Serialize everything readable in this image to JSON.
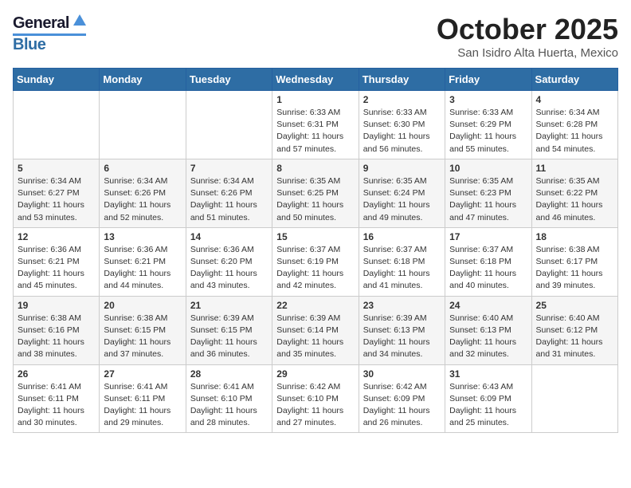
{
  "logo": {
    "general": "General",
    "blue": "Blue"
  },
  "header": {
    "month": "October 2025",
    "location": "San Isidro Alta Huerta, Mexico"
  },
  "days": [
    "Sunday",
    "Monday",
    "Tuesday",
    "Wednesday",
    "Thursday",
    "Friday",
    "Saturday"
  ],
  "weeks": [
    [
      {
        "day": "",
        "info": ""
      },
      {
        "day": "",
        "info": ""
      },
      {
        "day": "",
        "info": ""
      },
      {
        "day": "1",
        "sunrise": "Sunrise: 6:33 AM",
        "sunset": "Sunset: 6:31 PM",
        "daylight": "Daylight: 11 hours and 57 minutes."
      },
      {
        "day": "2",
        "sunrise": "Sunrise: 6:33 AM",
        "sunset": "Sunset: 6:30 PM",
        "daylight": "Daylight: 11 hours and 56 minutes."
      },
      {
        "day": "3",
        "sunrise": "Sunrise: 6:33 AM",
        "sunset": "Sunset: 6:29 PM",
        "daylight": "Daylight: 11 hours and 55 minutes."
      },
      {
        "day": "4",
        "sunrise": "Sunrise: 6:34 AM",
        "sunset": "Sunset: 6:28 PM",
        "daylight": "Daylight: 11 hours and 54 minutes."
      }
    ],
    [
      {
        "day": "5",
        "sunrise": "Sunrise: 6:34 AM",
        "sunset": "Sunset: 6:27 PM",
        "daylight": "Daylight: 11 hours and 53 minutes."
      },
      {
        "day": "6",
        "sunrise": "Sunrise: 6:34 AM",
        "sunset": "Sunset: 6:26 PM",
        "daylight": "Daylight: 11 hours and 52 minutes."
      },
      {
        "day": "7",
        "sunrise": "Sunrise: 6:34 AM",
        "sunset": "Sunset: 6:26 PM",
        "daylight": "Daylight: 11 hours and 51 minutes."
      },
      {
        "day": "8",
        "sunrise": "Sunrise: 6:35 AM",
        "sunset": "Sunset: 6:25 PM",
        "daylight": "Daylight: 11 hours and 50 minutes."
      },
      {
        "day": "9",
        "sunrise": "Sunrise: 6:35 AM",
        "sunset": "Sunset: 6:24 PM",
        "daylight": "Daylight: 11 hours and 49 minutes."
      },
      {
        "day": "10",
        "sunrise": "Sunrise: 6:35 AM",
        "sunset": "Sunset: 6:23 PM",
        "daylight": "Daylight: 11 hours and 47 minutes."
      },
      {
        "day": "11",
        "sunrise": "Sunrise: 6:35 AM",
        "sunset": "Sunset: 6:22 PM",
        "daylight": "Daylight: 11 hours and 46 minutes."
      }
    ],
    [
      {
        "day": "12",
        "sunrise": "Sunrise: 6:36 AM",
        "sunset": "Sunset: 6:21 PM",
        "daylight": "Daylight: 11 hours and 45 minutes."
      },
      {
        "day": "13",
        "sunrise": "Sunrise: 6:36 AM",
        "sunset": "Sunset: 6:21 PM",
        "daylight": "Daylight: 11 hours and 44 minutes."
      },
      {
        "day": "14",
        "sunrise": "Sunrise: 6:36 AM",
        "sunset": "Sunset: 6:20 PM",
        "daylight": "Daylight: 11 hours and 43 minutes."
      },
      {
        "day": "15",
        "sunrise": "Sunrise: 6:37 AM",
        "sunset": "Sunset: 6:19 PM",
        "daylight": "Daylight: 11 hours and 42 minutes."
      },
      {
        "day": "16",
        "sunrise": "Sunrise: 6:37 AM",
        "sunset": "Sunset: 6:18 PM",
        "daylight": "Daylight: 11 hours and 41 minutes."
      },
      {
        "day": "17",
        "sunrise": "Sunrise: 6:37 AM",
        "sunset": "Sunset: 6:18 PM",
        "daylight": "Daylight: 11 hours and 40 minutes."
      },
      {
        "day": "18",
        "sunrise": "Sunrise: 6:38 AM",
        "sunset": "Sunset: 6:17 PM",
        "daylight": "Daylight: 11 hours and 39 minutes."
      }
    ],
    [
      {
        "day": "19",
        "sunrise": "Sunrise: 6:38 AM",
        "sunset": "Sunset: 6:16 PM",
        "daylight": "Daylight: 11 hours and 38 minutes."
      },
      {
        "day": "20",
        "sunrise": "Sunrise: 6:38 AM",
        "sunset": "Sunset: 6:15 PM",
        "daylight": "Daylight: 11 hours and 37 minutes."
      },
      {
        "day": "21",
        "sunrise": "Sunrise: 6:39 AM",
        "sunset": "Sunset: 6:15 PM",
        "daylight": "Daylight: 11 hours and 36 minutes."
      },
      {
        "day": "22",
        "sunrise": "Sunrise: 6:39 AM",
        "sunset": "Sunset: 6:14 PM",
        "daylight": "Daylight: 11 hours and 35 minutes."
      },
      {
        "day": "23",
        "sunrise": "Sunrise: 6:39 AM",
        "sunset": "Sunset: 6:13 PM",
        "daylight": "Daylight: 11 hours and 34 minutes."
      },
      {
        "day": "24",
        "sunrise": "Sunrise: 6:40 AM",
        "sunset": "Sunset: 6:13 PM",
        "daylight": "Daylight: 11 hours and 32 minutes."
      },
      {
        "day": "25",
        "sunrise": "Sunrise: 6:40 AM",
        "sunset": "Sunset: 6:12 PM",
        "daylight": "Daylight: 11 hours and 31 minutes."
      }
    ],
    [
      {
        "day": "26",
        "sunrise": "Sunrise: 6:41 AM",
        "sunset": "Sunset: 6:11 PM",
        "daylight": "Daylight: 11 hours and 30 minutes."
      },
      {
        "day": "27",
        "sunrise": "Sunrise: 6:41 AM",
        "sunset": "Sunset: 6:11 PM",
        "daylight": "Daylight: 11 hours and 29 minutes."
      },
      {
        "day": "28",
        "sunrise": "Sunrise: 6:41 AM",
        "sunset": "Sunset: 6:10 PM",
        "daylight": "Daylight: 11 hours and 28 minutes."
      },
      {
        "day": "29",
        "sunrise": "Sunrise: 6:42 AM",
        "sunset": "Sunset: 6:10 PM",
        "daylight": "Daylight: 11 hours and 27 minutes."
      },
      {
        "day": "30",
        "sunrise": "Sunrise: 6:42 AM",
        "sunset": "Sunset: 6:09 PM",
        "daylight": "Daylight: 11 hours and 26 minutes."
      },
      {
        "day": "31",
        "sunrise": "Sunrise: 6:43 AM",
        "sunset": "Sunset: 6:09 PM",
        "daylight": "Daylight: 11 hours and 25 minutes."
      },
      {
        "day": "",
        "info": ""
      }
    ]
  ]
}
